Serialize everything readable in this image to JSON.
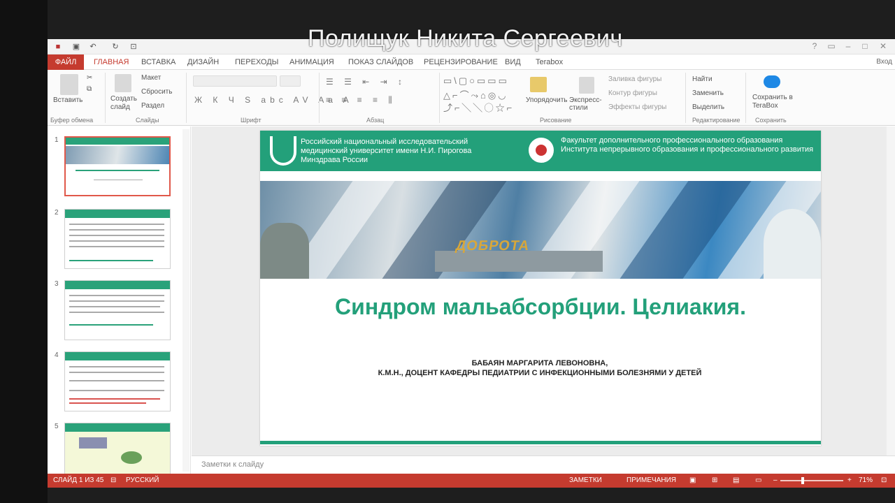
{
  "overlay": {
    "presenter_name": "Полищук Никита Сергеевич"
  },
  "menubar": {
    "file": "ФАЙЛ",
    "tabs": [
      "ГЛАВНАЯ",
      "ВСТАВКА",
      "ДИЗАЙН",
      "ПЕРЕХОДЫ",
      "АНИМАЦИЯ",
      "ПОКАЗ СЛАЙДОВ",
      "РЕЦЕНЗИРОВАНИЕ",
      "ВИД",
      "Terabox"
    ]
  },
  "ribbon": {
    "paste": "Вставить",
    "new_slide": "Создать слайд",
    "layout": "Макет",
    "reset": "Сбросить",
    "section": "Раздел",
    "arrange": "Упорядочить",
    "quick_styles": "Экспресс-стили",
    "shape_fill": "Заливка фигуры",
    "shape_outline": "Контур фигуры",
    "shape_effects": "Эффекты фигуры",
    "find": "Найти",
    "replace": "Заменить",
    "select": "Выделить",
    "save_terabox": "Сохранить в TeraBox",
    "groups": [
      "Буфер обмена",
      "Слайды",
      "Шрифт",
      "Абзац",
      "Рисование",
      "Редактирование",
      "Сохранить"
    ]
  },
  "thumbnails": [
    {
      "number": "1",
      "selected": true
    },
    {
      "number": "2",
      "selected": false
    },
    {
      "number": "3",
      "selected": false
    },
    {
      "number": "4",
      "selected": false
    },
    {
      "number": "5",
      "selected": false
    }
  ],
  "slide": {
    "header_left": "Российский национальный исследовательский медицинский университет имени Н.И. Пирогова Минздрава России",
    "header_right": "Факультет дополнительного профессионального образования Института непрерывного образования и профессионального развития",
    "monument_text": "ДОБРОТА",
    "title": "Синдром мальабсорбции. Целиакия.",
    "author_name": "БАБАЯН МАРГАРИТА ЛЕВОНОВНА,",
    "author_title": "К.М.Н., ДОЦЕНТ КАФЕДРЫ ПЕДИАТРИИ С ИНФЕКЦИОННЫМИ БОЛЕЗНЯМИ У ДЕТЕЙ"
  },
  "notes": {
    "placeholder": "Заметки к слайду"
  },
  "status": {
    "slide_count": "СЛАЙД 1 ИЗ 45",
    "language": "РУССКИЙ",
    "notes_btn": "ЗАМЕТКИ",
    "comments_btn": "ПРИМЕЧАНИЯ",
    "zoom": "71%"
  },
  "colors": {
    "accent_red": "#c53b2f",
    "slide_green": "#23a07a"
  }
}
